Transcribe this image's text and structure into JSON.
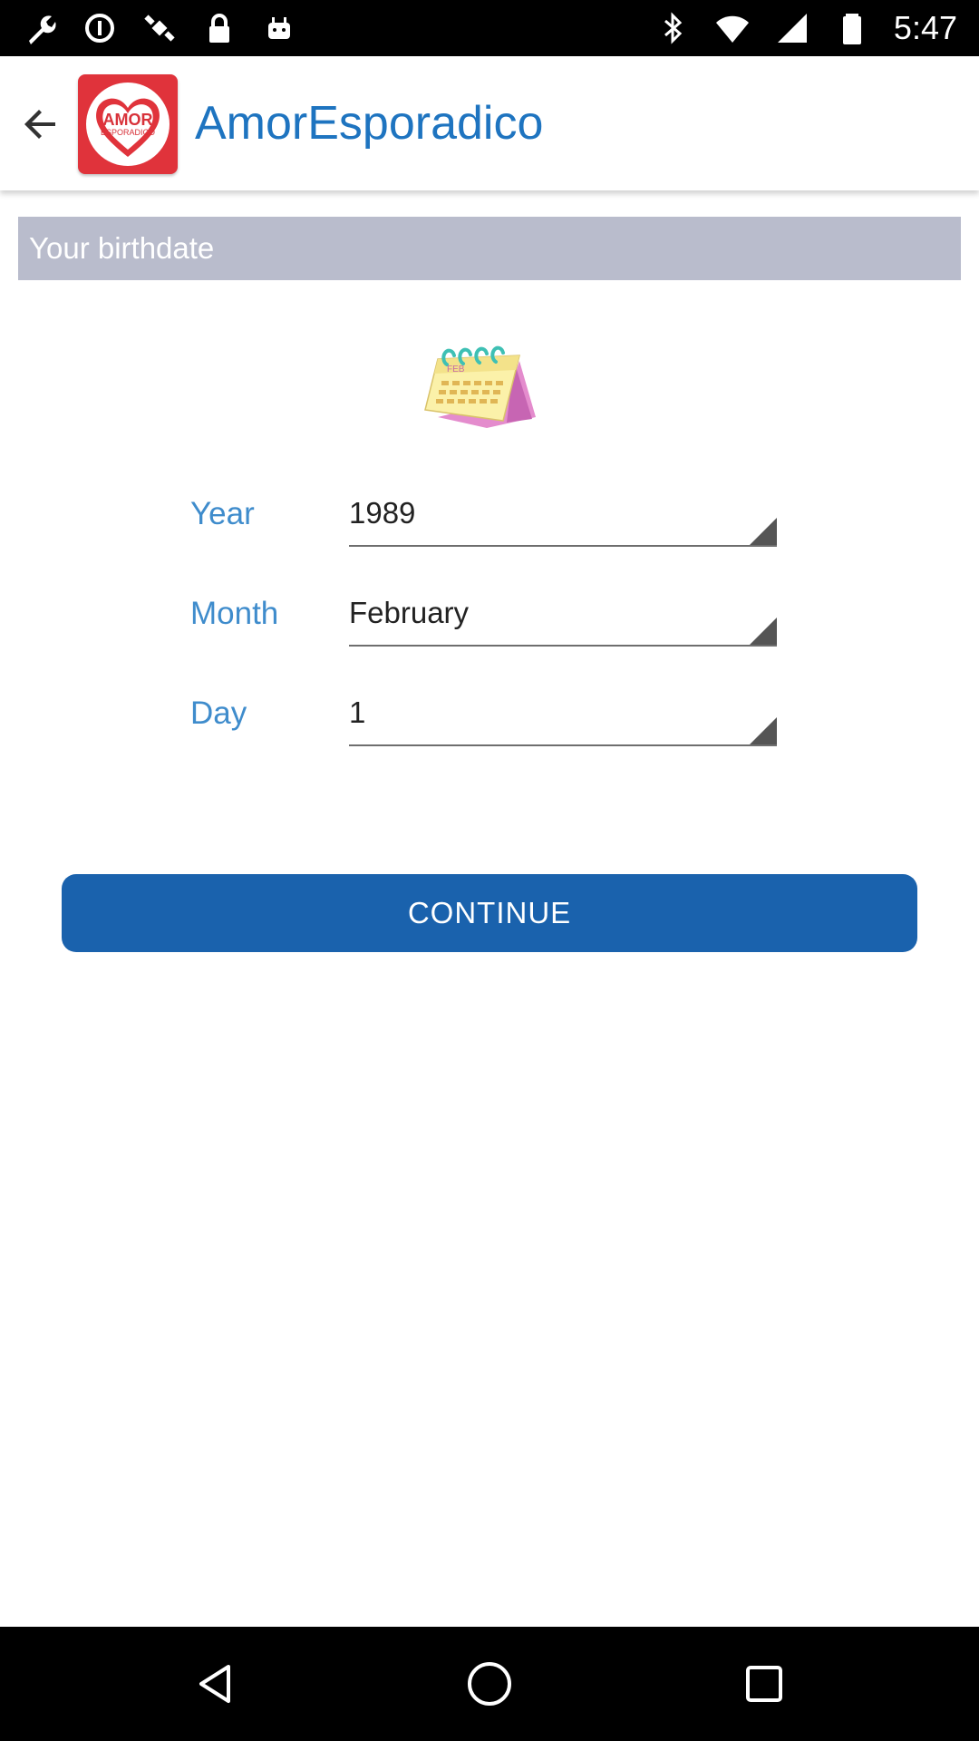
{
  "status_bar": {
    "time": "5:47",
    "left_icons": [
      "wrench-icon",
      "data-saver-icon",
      "fake-gps-icon",
      "lock-icon",
      "android-icon"
    ],
    "right_icons": [
      "bluetooth-icon",
      "wifi-icon",
      "signal-icon",
      "battery-icon"
    ]
  },
  "app_bar": {
    "title": "AmorEsporadico",
    "logo_text": "AMOR",
    "logo_subtext": "ESPORADICO",
    "accent_color": "#1e74c0"
  },
  "section": {
    "title": "Your birthdate"
  },
  "calendar_art": {
    "month_text": "FEB"
  },
  "form": {
    "year": {
      "label": "Year",
      "value": "1989"
    },
    "month": {
      "label": "Month",
      "value": "February"
    },
    "day": {
      "label": "Day",
      "value": "1"
    }
  },
  "continue_button": {
    "label": "CONTINUE",
    "color": "#1a62ad"
  },
  "nav_bar": {
    "icons": [
      "back-triangle-icon",
      "home-circle-icon",
      "recents-square-icon"
    ]
  }
}
